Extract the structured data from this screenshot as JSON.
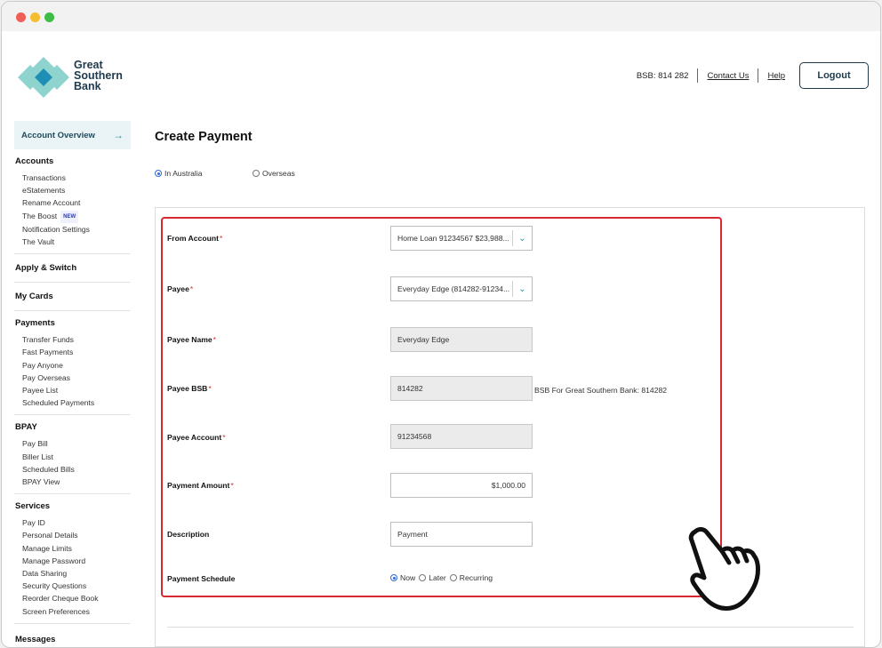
{
  "brand": {
    "line1": "Great",
    "line2": "Southern",
    "line3": "Bank"
  },
  "header": {
    "bsb": "BSB: 814 282",
    "contact": "Contact Us",
    "help": "Help",
    "logout": "Logout"
  },
  "sidebar": {
    "overview": "Account Overview",
    "sections": [
      {
        "title": "Accounts",
        "items": [
          "Transactions",
          "eStatements",
          "Rename Account",
          "The Boost",
          "Notification Settings",
          "The Vault"
        ],
        "badge": "NEW"
      },
      {
        "title": "Apply & Switch"
      },
      {
        "title": "My Cards"
      },
      {
        "title": "Payments",
        "items": [
          "Transfer Funds",
          "Fast Payments",
          "Pay Anyone",
          "Pay Overseas",
          "Payee List",
          "Scheduled Payments"
        ]
      },
      {
        "title": "BPAY",
        "items": [
          "Pay Bill",
          "Biller List",
          "Scheduled Bills",
          "BPAY View"
        ]
      },
      {
        "title": "Services",
        "items": [
          "Pay ID",
          "Personal Details",
          "Manage Limits",
          "Manage Password",
          "Data Sharing",
          "Security Questions",
          "Reorder Cheque Book",
          "Screen Preferences"
        ]
      },
      {
        "title": "Messages"
      }
    ]
  },
  "main": {
    "title": "Create Payment",
    "location_options": [
      "In Australia",
      "Overseas"
    ],
    "location_selected": "In Australia",
    "form": {
      "from_account": {
        "label": "From Account",
        "value": "Home Loan 91234567 $23,988..."
      },
      "payee": {
        "label": "Payee",
        "value": "Everyday Edge (814282-91234..."
      },
      "payee_name": {
        "label": "Payee Name",
        "value": "Everyday Edge"
      },
      "payee_bsb": {
        "label": "Payee BSB",
        "value": "814282",
        "hint": "BSB For Great Southern Bank: 814282"
      },
      "payee_account": {
        "label": "Payee Account",
        "value": "91234568"
      },
      "amount": {
        "label": "Payment Amount",
        "value": "$1,000.00"
      },
      "description": {
        "label": "Description",
        "value": "Payment"
      },
      "schedule": {
        "label": "Payment Schedule",
        "options": [
          "Now",
          "Later",
          "Recurring"
        ],
        "selected": "Now"
      }
    },
    "required_marker": "*"
  },
  "colors": {
    "accent": "#2b8fa8",
    "highlight": "#d6282e",
    "brand_dark": "#1e3a4c"
  },
  "icons": {
    "overview_arrow": "arrow-right-icon",
    "dropdown": "chevron-down-icon",
    "pointer": "pointing-hand-icon"
  }
}
